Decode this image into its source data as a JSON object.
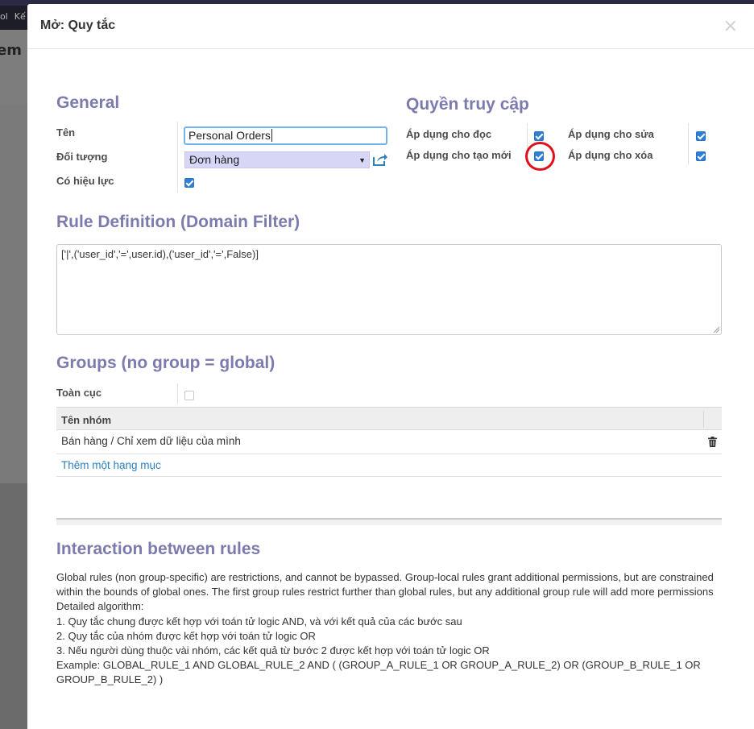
{
  "background": {
    "menu_items": [
      "ol",
      "Kế"
    ],
    "panel_text": "em d"
  },
  "dialog": {
    "title": "Mở: Quy tắc",
    "close_label": "×"
  },
  "general": {
    "title": "General",
    "name_label": "Tên",
    "name_value": "Personal Orders",
    "model_label": "Đối tượng",
    "model_value": "Đơn hàng",
    "active_label": "Có hiệu lực",
    "active": true
  },
  "access": {
    "title": "Quyền truy cập",
    "read_label": "Áp dụng cho đọc",
    "read": true,
    "write_label": "Áp dụng cho sửa",
    "write": true,
    "create_label": "Áp dụng cho tạo mới",
    "create": true,
    "delete_label": "Áp dụng cho xóa",
    "delete": true
  },
  "domain": {
    "title": "Rule Definition (Domain Filter)",
    "value": "['|',('user_id','=',user.id),('user_id','=',False)]"
  },
  "groups": {
    "title": "Groups (no group = global)",
    "global_label": "Toàn cục",
    "global": false,
    "column_header": "Tên nhóm",
    "rows": [
      "Bán hàng / Chỉ xem dữ liệu của mình"
    ],
    "add_item_label": "Thêm một hạng mục"
  },
  "interaction": {
    "title": "Interaction between rules",
    "paragraph": "Global rules (non group-specific) are restrictions, and cannot be bypassed. Group-local rules grant additional permissions, but are constrained within the bounds of global ones. The first group rules restrict further than global rules, but any additional group rule will add more permissions",
    "algo_title": "Detailed algorithm:",
    "step1": "1. Quy tắc chung được kết hợp với toán tử logic AND, và với kết quả của các bước sau",
    "step2": "2. Quy tắc của nhóm được kết hợp với toán tử logic OR",
    "step3": "3. Nếu người dùng thuộc vài nhóm, các kết quả từ bước 2 được kết hợp với toán tử logic OR",
    "example": "Example: GLOBAL_RULE_1 AND GLOBAL_RULE_2 AND ( (GROUP_A_RULE_1 OR GROUP_A_RULE_2) OR (GROUP_B_RULE_1 OR GROUP_B_RULE_2) )"
  },
  "colors": {
    "section_title": "#7c7bad",
    "checkbox_checked": "#2f7fd8",
    "link": "#2b7fc2",
    "select_bg": "#d7d6f7",
    "highlight_ring": "#e0101a"
  },
  "icons": {
    "external_link": "external-link-icon",
    "trash": "trash-icon",
    "close": "close-icon",
    "caret": "caret-down-icon"
  }
}
